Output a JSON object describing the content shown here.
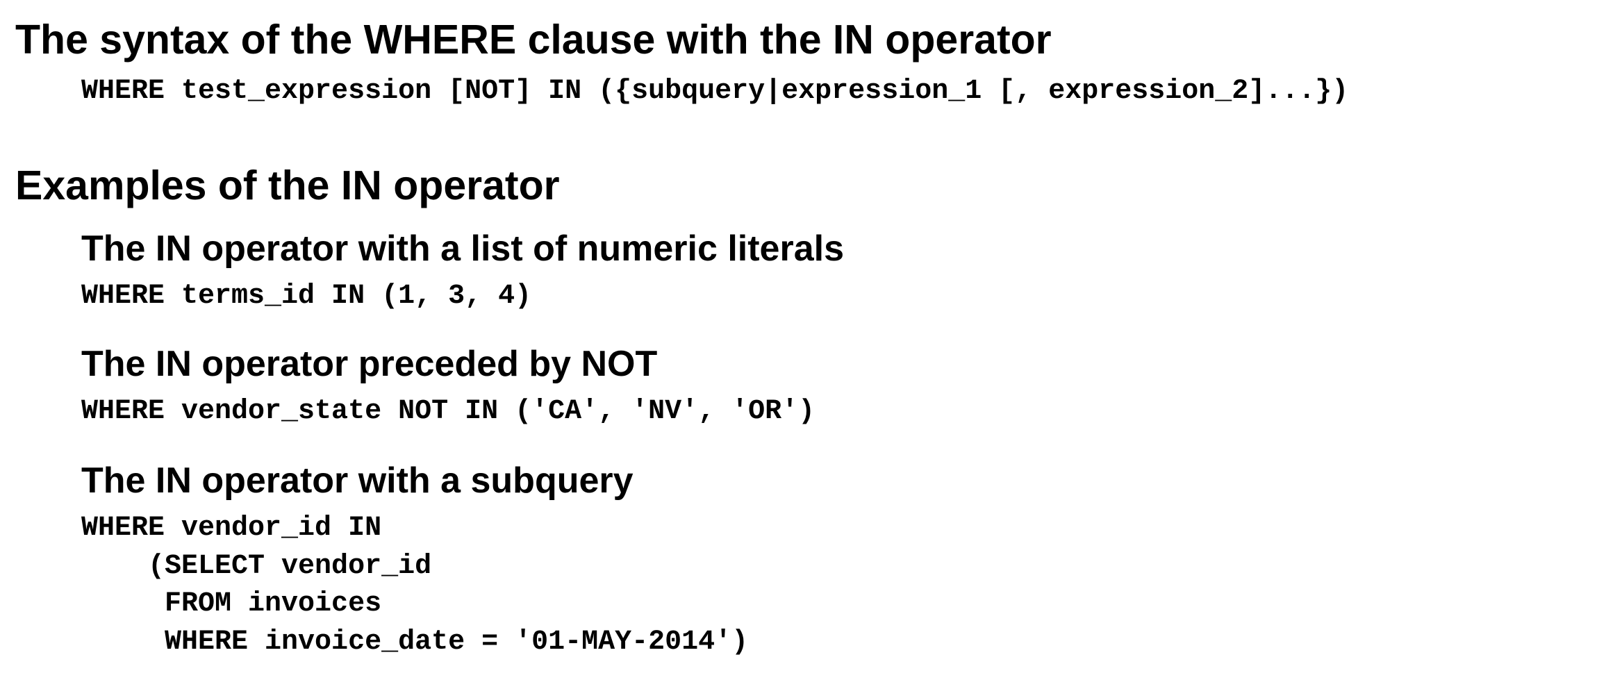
{
  "syntax": {
    "heading": "The syntax of the WHERE clause with the IN operator",
    "code": "WHERE test_expression [NOT] IN ({subquery|expression_1 [, expression_2]...})"
  },
  "examples": {
    "heading": "Examples of the IN operator",
    "items": [
      {
        "title": "The IN operator with a list of numeric literals",
        "code": [
          "WHERE terms_id IN (1, 3, 4)"
        ]
      },
      {
        "title": "The IN operator preceded by NOT",
        "code": [
          "WHERE vendor_state NOT IN ('CA', 'NV', 'OR')"
        ]
      },
      {
        "title": "The IN operator with a subquery",
        "code": [
          "WHERE vendor_id IN",
          "    (SELECT vendor_id",
          "     FROM invoices",
          "     WHERE invoice_date = '01-MAY-2014')"
        ]
      }
    ]
  }
}
